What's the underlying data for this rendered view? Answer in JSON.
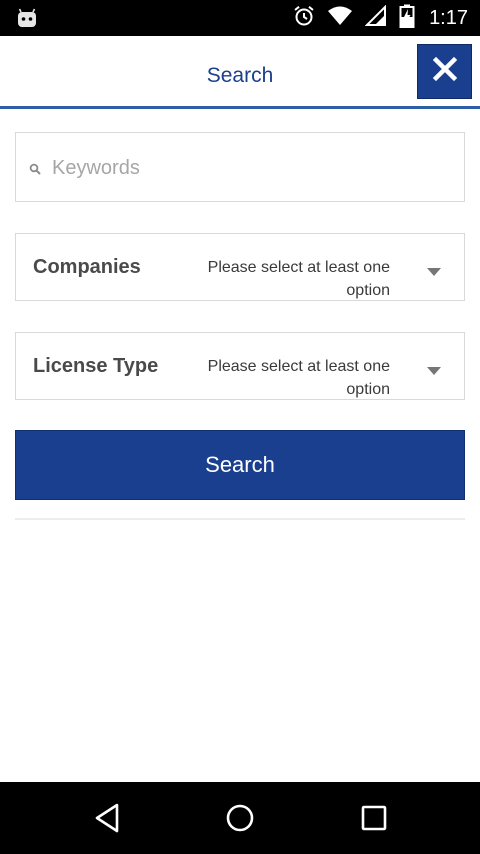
{
  "status_bar": {
    "time": "1:17",
    "icons": [
      "android-icon",
      "alarm-icon",
      "wifi-icon",
      "signal-icon",
      "battery-charging-icon"
    ]
  },
  "header": {
    "title": "Search",
    "close_icon": "close-icon"
  },
  "form": {
    "keywords": {
      "placeholder": "Keywords",
      "value": ""
    },
    "companies": {
      "label": "Companies",
      "value": "Please select at least one option"
    },
    "license_type": {
      "label": "License Type",
      "value": "Please select at least one option"
    },
    "search_label": "Search"
  },
  "nav": {
    "icons": [
      "back-icon",
      "home-icon",
      "recents-icon"
    ]
  },
  "colors": {
    "primary": "#1a3f8f",
    "header_underline": "#2e5ea6",
    "status_bar": "#000000"
  }
}
